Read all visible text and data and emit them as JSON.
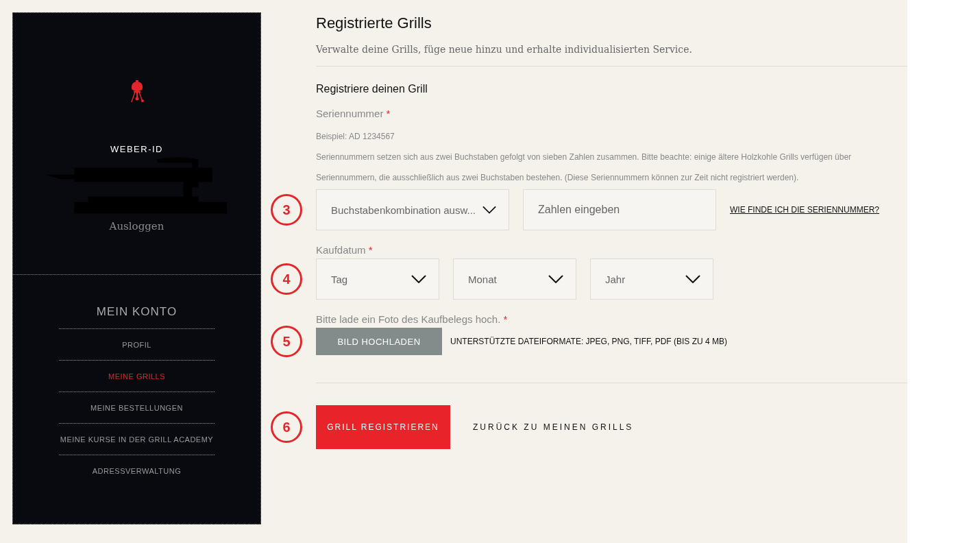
{
  "sidebar": {
    "id_label": "WEBER-ID",
    "logout": "Ausloggen",
    "nav_title": "MEIN KONTO",
    "items": [
      {
        "label": "PROFIL",
        "selected": false
      },
      {
        "label": "MEINE GRILLS",
        "selected": true
      },
      {
        "label": "MEINE BESTELLUNGEN",
        "selected": false
      },
      {
        "label": "MEINE KURSE IN DER GRILL ACADEMY",
        "selected": false
      },
      {
        "label": "ADRESSVERWALTUNG",
        "selected": false
      }
    ]
  },
  "main": {
    "title": "Registrierte Grills",
    "subtitle": "Verwalte deine Grills, füge neue hinzu und erhalte individualisierten Service.",
    "form_title": "Registriere deinen Grill",
    "serial": {
      "label": "Seriennummer",
      "required": "*",
      "example": "Beispiel: AD 1234567",
      "hint": "Seriennummern setzen sich aus zwei Buchstaben gefolgt von sieben Zahlen zusammen. Bitte beachte: einige ältere Holzkohle Grills verfügen über Seriennummern, die ausschließlich aus zwei Buchstaben bestehen. (Diese Seriennummern können zur Zeit nicht registriert werden).",
      "marker": "3",
      "select": "Buchstabenkombination ausw...",
      "input_placeholder": "Zahlen eingeben",
      "help_link": "WIE FINDE ICH DIE SERIENNUMMER?"
    },
    "date": {
      "label": "Kaufdatum",
      "required": "*",
      "marker": "4",
      "selects": [
        "Tag",
        "Monat",
        "Jahr"
      ]
    },
    "upload": {
      "label": "Bitte lade ein Foto des Kaufbelegs hoch.",
      "required": "*",
      "marker": "5",
      "button": "BILD HOCHLADEN",
      "formats": "UNTERSTÜTZTE DATEIFORMATE: JPEG, PNG, TIFF, PDF (BIS ZU 4 MB)"
    },
    "actions": {
      "marker": "6",
      "submit": "GRILL REGISTRIEREN",
      "back": "ZURÜCK ZU MEINEN GRILLS"
    }
  }
}
